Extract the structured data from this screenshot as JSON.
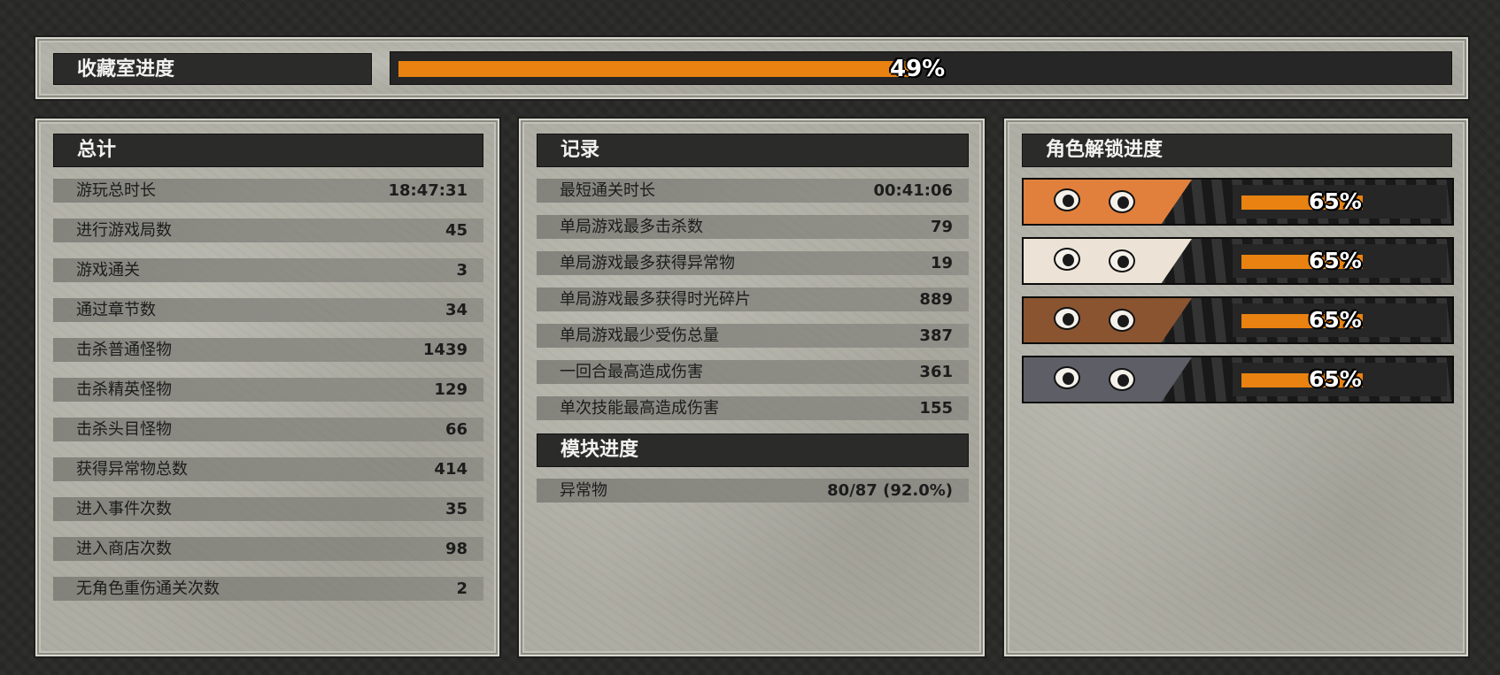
{
  "collection": {
    "label": "收藏室进度",
    "percent_text": "49%",
    "percent": 49
  },
  "totals": {
    "title": "总计",
    "rows": [
      {
        "label": "游玩总时长",
        "value": "18:47:31"
      },
      {
        "label": "进行游戏局数",
        "value": "45"
      },
      {
        "label": "游戏通关",
        "value": "3"
      },
      {
        "label": "通过章节数",
        "value": "34"
      },
      {
        "label": "击杀普通怪物",
        "value": "1439"
      },
      {
        "label": "击杀精英怪物",
        "value": "129"
      },
      {
        "label": "击杀头目怪物",
        "value": "66"
      },
      {
        "label": "获得异常物总数",
        "value": "414"
      },
      {
        "label": "进入事件次数",
        "value": "35"
      },
      {
        "label": "进入商店次数",
        "value": "98"
      },
      {
        "label": "无角色重伤通关次数",
        "value": "2"
      }
    ]
  },
  "records": {
    "title": "记录",
    "rows": [
      {
        "label": "最短通关时长",
        "value": "00:41:06"
      },
      {
        "label": "单局游戏最多击杀数",
        "value": "79"
      },
      {
        "label": "单局游戏最多获得异常物",
        "value": "19"
      },
      {
        "label": "单局游戏最多获得时光碎片",
        "value": "889"
      },
      {
        "label": "单局游戏最少受伤总量",
        "value": "387"
      },
      {
        "label": "一回合最高造成伤害",
        "value": "361"
      },
      {
        "label": "单次技能最高造成伤害",
        "value": "155"
      }
    ]
  },
  "modules": {
    "title": "模块进度",
    "rows": [
      {
        "label": "异常物",
        "value": "80/87 (92.0%)"
      }
    ]
  },
  "characters": {
    "title": "角色解锁进度",
    "items": [
      {
        "name": "fox-character",
        "percent_text": "65%",
        "percent": 65,
        "fur": "#e0803c",
        "accent": "#5a3a22"
      },
      {
        "name": "cat-character",
        "percent_text": "65%",
        "percent": 65,
        "fur": "#ece3d6",
        "accent": "#6a4a3e"
      },
      {
        "name": "bear-character",
        "percent_text": "65%",
        "percent": 65,
        "fur": "#8a5431",
        "accent": "#1d4a4c"
      },
      {
        "name": "wolf-character",
        "percent_text": "65%",
        "percent": 65,
        "fur": "#5e5f66",
        "accent": "#4a4338"
      }
    ]
  },
  "colors": {
    "accent_orange": "#e98211",
    "header_dark": "#2b2b2a",
    "paper": "#aeada3"
  }
}
